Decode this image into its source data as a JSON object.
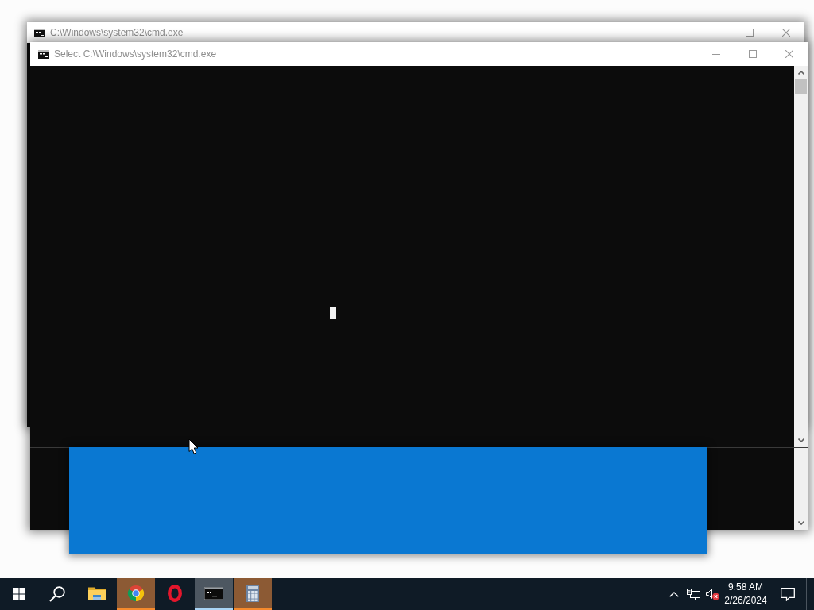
{
  "windows": [
    {
      "title": "C:\\Windows\\system32\\cmd.exe"
    },
    {
      "title": "Select C:\\Windows\\system32\\cmd.exe"
    }
  ],
  "taskbar": {
    "apps": [
      {
        "kind": "folder",
        "active": false,
        "flashing": false
      },
      {
        "kind": "browser",
        "active": false,
        "flashing": true
      },
      {
        "kind": "ring",
        "active": false,
        "flashing": false
      },
      {
        "kind": "terminal",
        "active": true,
        "flashing": false
      },
      {
        "kind": "calculator",
        "active": false,
        "flashing": true
      }
    ],
    "volume_muted": true,
    "clock": {
      "time": "9:58 AM",
      "date": "2/26/2024"
    }
  }
}
